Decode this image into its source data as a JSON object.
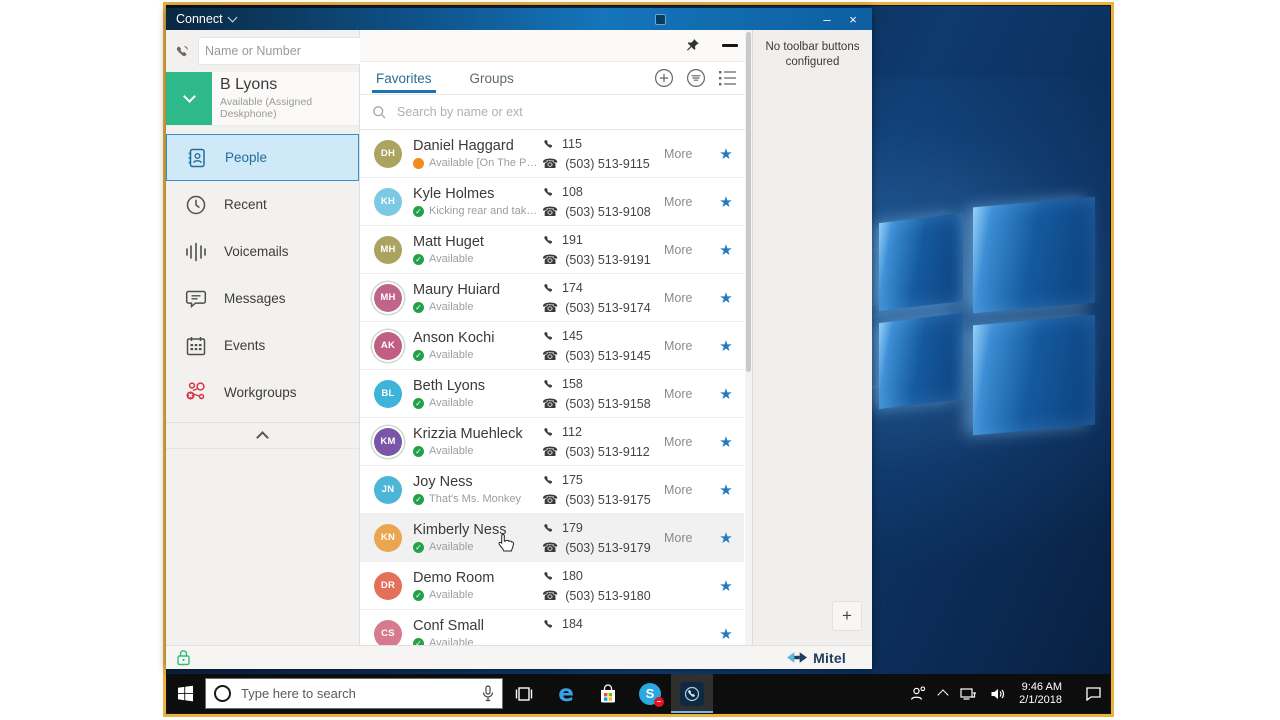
{
  "colors": {
    "accent_blue": "#1a74b8",
    "star_blue": "#1d7cc2",
    "available_green": "#23a24a",
    "busy_orange": "#f28a1e",
    "workgroups_red": "#d63644",
    "user_square_green": "#2eb98b",
    "frame_gold": "#eab23f",
    "titlebar_blue": "#1575ba"
  },
  "title_bar": {
    "app_menu_label": "Connect",
    "minimize_glyph": "–",
    "close_glyph": "×"
  },
  "sidebar": {
    "quick_dial_placeholder": "Name or Number",
    "user": {
      "name": "B Lyons",
      "status": "Available (Assigned Deskphone)"
    },
    "items": [
      {
        "label": "People",
        "icon": "people-icon",
        "active": true
      },
      {
        "label": "Recent",
        "icon": "recent-icon",
        "active": false
      },
      {
        "label": "Voicemails",
        "icon": "voicemails-icon",
        "active": false
      },
      {
        "label": "Messages",
        "icon": "messages-icon",
        "active": false
      },
      {
        "label": "Events",
        "icon": "events-icon",
        "active": false
      },
      {
        "label": "Workgroups",
        "icon": "workgroups-icon",
        "active": false
      }
    ]
  },
  "content": {
    "tabs": [
      {
        "label": "Favorites",
        "active": true
      },
      {
        "label": "Groups",
        "active": false
      }
    ],
    "header_icons": [
      "add-icon",
      "filter-icon",
      "list-view-icon"
    ],
    "window_icons": [
      "pin-icon",
      "collapse-dash-icon"
    ],
    "search_placeholder": "Search by name or ext",
    "rows": [
      {
        "initials": "DH",
        "name": "Daniel Haggard",
        "status": "Available [On The Phone]",
        "presence": "busy",
        "ext": "115",
        "phone": "(503) 513-9115",
        "more": "More",
        "color": "#aba35f",
        "ring": false,
        "highlighted": false
      },
      {
        "initials": "KH",
        "name": "Kyle Holmes",
        "status": "Kicking rear and taking n..",
        "presence": "available",
        "ext": "108",
        "phone": "(503) 513-9108",
        "more": "More",
        "color": "#7cc9e4",
        "ring": false,
        "highlighted": false
      },
      {
        "initials": "MH",
        "name": "Matt Huget",
        "status": "Available",
        "presence": "available",
        "ext": "191",
        "phone": "(503) 513-9191",
        "more": "More",
        "color": "#aba35f",
        "ring": false,
        "highlighted": false
      },
      {
        "initials": "MH",
        "name": "Maury Huiard",
        "status": "Available",
        "presence": "available",
        "ext": "174",
        "phone": "(503) 513-9174",
        "more": "More",
        "color": "#c0648c",
        "ring": true,
        "highlighted": false
      },
      {
        "initials": "AK",
        "name": "Anson Kochi",
        "status": "Available",
        "presence": "available",
        "ext": "145",
        "phone": "(503) 513-9145",
        "more": "More",
        "color": "#c05f83",
        "ring": true,
        "highlighted": false
      },
      {
        "initials": "BL",
        "name": "Beth Lyons",
        "status": "Available",
        "presence": "available",
        "ext": "158",
        "phone": "(503) 513-9158",
        "more": "More",
        "color": "#3db4da",
        "ring": false,
        "highlighted": false
      },
      {
        "initials": "KM",
        "name": "Krizzia Muehleck",
        "status": "Available",
        "presence": "available",
        "ext": "112",
        "phone": "(503) 513-9112",
        "more": "More",
        "color": "#7a55a8",
        "ring": true,
        "highlighted": false
      },
      {
        "initials": "JN",
        "name": "Joy Ness",
        "status": "That's Ms. Monkey",
        "presence": "available",
        "ext": "175",
        "phone": "(503) 513-9175",
        "more": "More",
        "color": "#4db5d8",
        "ring": false,
        "highlighted": false
      },
      {
        "initials": "KN",
        "name": "Kimberly Ness",
        "status": "Available",
        "presence": "available",
        "ext": "179",
        "phone": "(503) 513-9179",
        "more": "More",
        "color": "#e9a54f",
        "ring": false,
        "highlighted": true
      },
      {
        "initials": "DR",
        "name": "Demo Room",
        "status": "Available",
        "presence": "available",
        "ext": "180",
        "phone": "(503) 513-9180",
        "more": "",
        "color": "#e2705a",
        "ring": false,
        "highlighted": false
      },
      {
        "initials": "CS",
        "name": "Conf Small",
        "status": "Available",
        "presence": "available",
        "ext": "184",
        "phone": "",
        "more": "",
        "color": "#d67a8e",
        "ring": false,
        "highlighted": false
      }
    ]
  },
  "toolbar_panel": {
    "message": "No toolbar buttons configured",
    "add_button_glyph": "+"
  },
  "status_bar": {
    "brand": "Mitel"
  },
  "taskbar": {
    "search_placeholder": "Type here to search",
    "clock_time": "9:46 AM",
    "clock_date": "2/1/2018"
  }
}
